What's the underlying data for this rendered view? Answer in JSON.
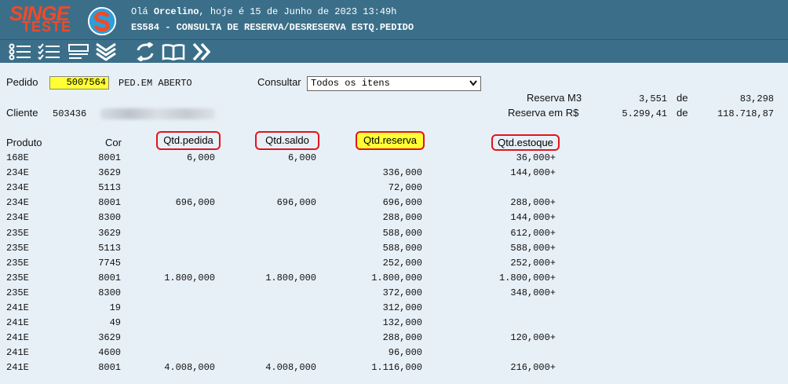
{
  "header": {
    "logo_top": "SINGE",
    "logo_bottom": "TESTE",
    "greeting_prefix": "Olá ",
    "user": "Orcelino",
    "greeting_suffix": ", hoje é 15 de Junho de 2023 13:49h",
    "title": "ES584 - CONSULTA DE RESERVA/DESRESERVA ESTQ.PEDIDO"
  },
  "toolbar": [
    "list-icon",
    "checklist-icon",
    "form-icon",
    "chevrons-down-icon",
    "refresh-icon",
    "book-icon",
    "fast-forward-icon"
  ],
  "form": {
    "pedido_label": "Pedido",
    "pedido_value": "5007564",
    "pedido_status": "PED.EM ABERTO",
    "consultar_label": "Consultar",
    "consultar_value": "Todos os itens",
    "cliente_label": "Cliente",
    "cliente_value": "503436"
  },
  "summary": {
    "reserva_m3_label": "Reserva M3",
    "reserva_m3_value": "3,551",
    "de_1": "de",
    "reserva_m3_total": "83,298",
    "reserva_rs_label": "Reserva em R$",
    "reserva_rs_value": "5.299,41",
    "de_2": "de",
    "reserva_rs_total": "118.718,87"
  },
  "table": {
    "headers": {
      "produto": "Produto",
      "cor": "Cor",
      "qtd_pedida": "Qtd.pedida",
      "qtd_saldo": "Qtd.saldo",
      "qtd_reserva": "Qtd.reserva",
      "qtd_estoque": "Qtd.estoque"
    },
    "rows": [
      {
        "produto": "168E",
        "cor": "8001",
        "pedida": "6,000",
        "saldo": "6,000",
        "reserva": "",
        "estoque": "36,000+"
      },
      {
        "produto": "234E",
        "cor": "3629",
        "pedida": "",
        "saldo": "",
        "reserva": "336,000",
        "estoque": "144,000+"
      },
      {
        "produto": "234E",
        "cor": "5113",
        "pedida": "",
        "saldo": "",
        "reserva": "72,000",
        "estoque": ""
      },
      {
        "produto": "234E",
        "cor": "8001",
        "pedida": "696,000",
        "saldo": "696,000",
        "reserva": "696,000",
        "estoque": "288,000+"
      },
      {
        "produto": "234E",
        "cor": "8300",
        "pedida": "",
        "saldo": "",
        "reserva": "288,000",
        "estoque": "144,000+"
      },
      {
        "produto": "235E",
        "cor": "3629",
        "pedida": "",
        "saldo": "",
        "reserva": "588,000",
        "estoque": "612,000+"
      },
      {
        "produto": "235E",
        "cor": "5113",
        "pedida": "",
        "saldo": "",
        "reserva": "588,000",
        "estoque": "588,000+"
      },
      {
        "produto": "235E",
        "cor": "7745",
        "pedida": "",
        "saldo": "",
        "reserva": "252,000",
        "estoque": "252,000+"
      },
      {
        "produto": "235E",
        "cor": "8001",
        "pedida": "1.800,000",
        "saldo": "1.800,000",
        "reserva": "1.800,000",
        "estoque": "1.800,000+"
      },
      {
        "produto": "235E",
        "cor": "8300",
        "pedida": "",
        "saldo": "",
        "reserva": "372,000",
        "estoque": "348,000+"
      },
      {
        "produto": "241E",
        "cor": "19",
        "pedida": "",
        "saldo": "",
        "reserva": "312,000",
        "estoque": ""
      },
      {
        "produto": "241E",
        "cor": "49",
        "pedida": "",
        "saldo": "",
        "reserva": "132,000",
        "estoque": ""
      },
      {
        "produto": "241E",
        "cor": "3629",
        "pedida": "",
        "saldo": "",
        "reserva": "288,000",
        "estoque": "120,000+"
      },
      {
        "produto": "241E",
        "cor": "4600",
        "pedida": "",
        "saldo": "",
        "reserva": "96,000",
        "estoque": ""
      },
      {
        "produto": "241E",
        "cor": "8001",
        "pedida": "4.008,000",
        "saldo": "4.008,000",
        "reserva": "1.116,000",
        "estoque": "216,000+"
      }
    ]
  },
  "colors": {
    "header_bg": "#3b6f89",
    "content_bg": "#e8f0f7",
    "logo_red": "#f04a2a",
    "highlight_yellow": "#ffff33",
    "circle_red": "#e0151b"
  }
}
